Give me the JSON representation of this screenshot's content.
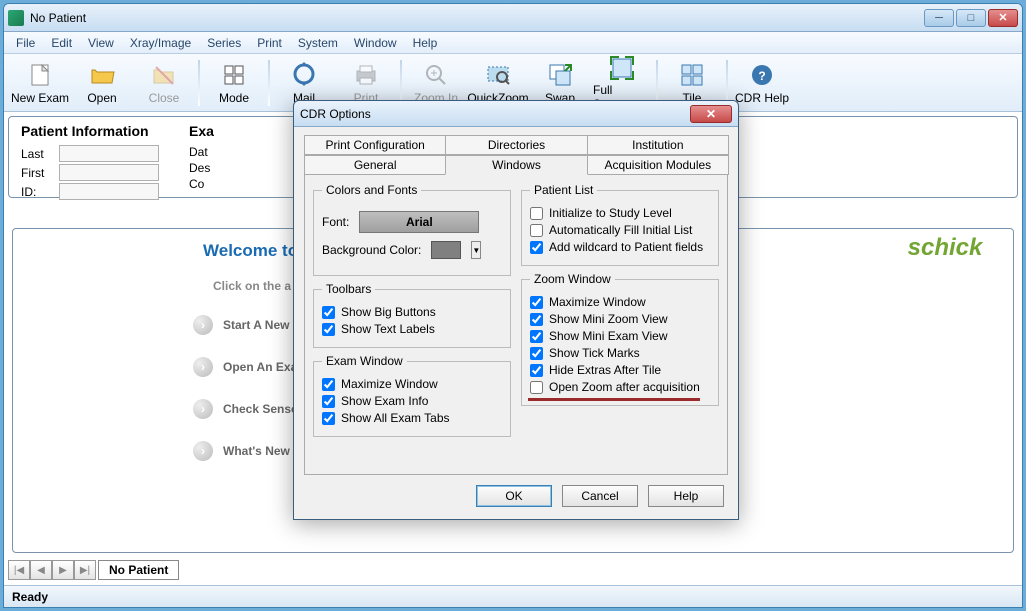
{
  "window": {
    "title": "No Patient"
  },
  "menu": [
    "File",
    "Edit",
    "View",
    "Xray/Image",
    "Series",
    "Print",
    "System",
    "Window",
    "Help"
  ],
  "toolbar": [
    {
      "label": "New Exam",
      "icon": "file-new",
      "enabled": true
    },
    {
      "label": "Open",
      "icon": "folder-open",
      "enabled": true
    },
    {
      "label": "Close",
      "icon": "folder-close",
      "enabled": false
    },
    {
      "sep": true
    },
    {
      "label": "Mode",
      "icon": "mode",
      "enabled": true
    },
    {
      "sep": true
    },
    {
      "label": "Mail",
      "icon": "mail",
      "enabled": true
    },
    {
      "label": "Print",
      "icon": "printer",
      "enabled": false
    },
    {
      "sep": true
    },
    {
      "label": "Zoom In",
      "icon": "zoom-in",
      "enabled": false
    },
    {
      "label": "QuickZoom",
      "icon": "quickzoom",
      "enabled": true
    },
    {
      "label": "Swap",
      "icon": "swap",
      "enabled": true
    },
    {
      "label": "Full Screen",
      "icon": "fullscreen",
      "enabled": true
    },
    {
      "sep": true
    },
    {
      "label": "Tile",
      "icon": "tile",
      "enabled": true
    },
    {
      "sep": true
    },
    {
      "label": "CDR Help",
      "icon": "help",
      "enabled": true
    }
  ],
  "patientInfo": {
    "title": "Patient Information",
    "fields": [
      "Last",
      "First",
      "ID:"
    ],
    "examTitle": "Exa",
    "examFields": [
      "Dat",
      "Des",
      "Co"
    ]
  },
  "welcome": {
    "title": "Welcome to",
    "sub": "Click on the a",
    "items": [
      "Start A New Exam",
      "Open An Exam",
      "Check Sensor Information",
      "What's New"
    ],
    "logo": "schick"
  },
  "tabstrip": {
    "label": "No Patient"
  },
  "status": "Ready",
  "dialog": {
    "title": "CDR Options",
    "tabsTop": [
      "Print Configuration",
      "Directories",
      "Institution"
    ],
    "tabsBottom": [
      "General",
      "Windows",
      "Acquisition Modules"
    ],
    "activeTab": "Windows",
    "colorsFonts": {
      "legend": "Colors and Fonts",
      "fontLabel": "Font:",
      "fontName": "Arial",
      "bgLabel": "Background Color:"
    },
    "toolbars": {
      "legend": "Toolbars",
      "opts": [
        {
          "label": "Show Big Buttons",
          "checked": true
        },
        {
          "label": "Show Text Labels",
          "checked": true
        }
      ]
    },
    "examWindow": {
      "legend": "Exam Window",
      "opts": [
        {
          "label": "Maximize Window",
          "checked": true
        },
        {
          "label": "Show Exam Info",
          "checked": true
        },
        {
          "label": "Show All Exam Tabs",
          "checked": true
        }
      ]
    },
    "patientList": {
      "legend": "Patient List",
      "opts": [
        {
          "label": "Initialize to Study Level",
          "checked": false
        },
        {
          "label": "Automatically Fill Initial List",
          "checked": false
        },
        {
          "label": "Add wildcard to Patient fields",
          "checked": true
        }
      ]
    },
    "zoomWindow": {
      "legend": "Zoom Window",
      "opts": [
        {
          "label": "Maximize Window",
          "checked": true
        },
        {
          "label": "Show Mini Zoom View",
          "checked": true
        },
        {
          "label": "Show Mini Exam View",
          "checked": true
        },
        {
          "label": "Show Tick Marks",
          "checked": true
        },
        {
          "label": "Hide Extras After Tile",
          "checked": true
        },
        {
          "label": "Open Zoom after acquisition",
          "checked": false
        }
      ]
    },
    "buttons": {
      "ok": "OK",
      "cancel": "Cancel",
      "help": "Help"
    }
  }
}
